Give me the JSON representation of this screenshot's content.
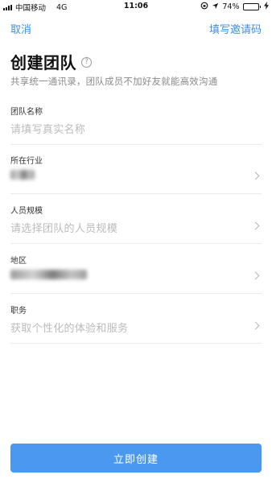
{
  "status_bar": {
    "carrier": "中国移动",
    "network": "4G",
    "time": "11:06",
    "battery": "74%",
    "battery_level": 0.74
  },
  "nav": {
    "cancel_label": "取消",
    "invite_code_label": "填写邀请码"
  },
  "header": {
    "title": "创建团队",
    "help_symbol": "?",
    "subtitle": "共享统一通讯录，团队成员不加好友就能高效沟通"
  },
  "form": {
    "team_name": {
      "label": "团队名称",
      "placeholder": "请填写真实名称"
    },
    "industry": {
      "label": "所在行业",
      "value": ""
    },
    "team_size": {
      "label": "人员规模",
      "placeholder": "请选择团队的人员规模"
    },
    "region": {
      "label": "地区",
      "value": ""
    },
    "position": {
      "label": "职务",
      "placeholder": "获取个性化的体验和服务"
    }
  },
  "actions": {
    "create_label": "立即创建"
  },
  "colors": {
    "accent": "#3d8ee6",
    "button": "#4b98f0",
    "placeholder": "#bbbbbb",
    "divider": "#ececec"
  },
  "icons": [
    "signal-icon",
    "location-icon",
    "battery-icon",
    "charging-icon",
    "help-icon",
    "chevron-right-icon"
  ]
}
